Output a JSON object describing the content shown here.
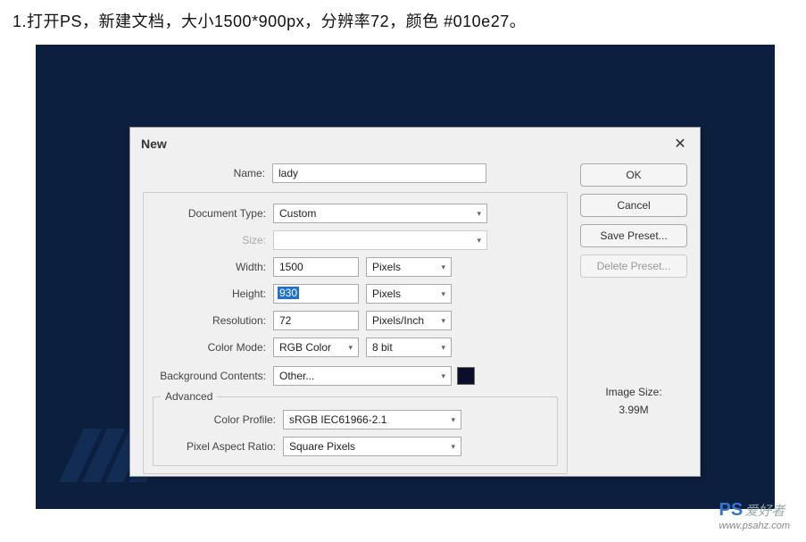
{
  "instruction": "1.打开PS，新建文档，大小1500*900px，分辨率72，颜色 #010e27。",
  "dialog": {
    "title": "New",
    "name_label": "Name:",
    "name_value": "lady",
    "doctype_label": "Document Type:",
    "doctype_value": "Custom",
    "size_label": "Size:",
    "size_value": "",
    "width_label": "Width:",
    "width_value": "1500",
    "width_unit": "Pixels",
    "height_label": "Height:",
    "height_value": "930",
    "height_unit": "Pixels",
    "res_label": "Resolution:",
    "res_value": "72",
    "res_unit": "Pixels/Inch",
    "mode_label": "Color Mode:",
    "mode_value": "RGB Color",
    "mode_depth": "8 bit",
    "bg_label": "Background Contents:",
    "bg_value": "Other...",
    "bg_color": "#0a0e2a",
    "advanced_label": "Advanced",
    "profile_label": "Color Profile:",
    "profile_value": "sRGB IEC61966-2.1",
    "par_label": "Pixel Aspect Ratio:",
    "par_value": "Square Pixels",
    "ok": "OK",
    "cancel": "Cancel",
    "save_preset": "Save Preset...",
    "delete_preset": "Delete Preset...",
    "image_size_label": "Image Size:",
    "image_size_value": "3.99M"
  },
  "watermark": {
    "brand": "PS",
    "text": "爱好者",
    "url": "www.psahz.com"
  }
}
